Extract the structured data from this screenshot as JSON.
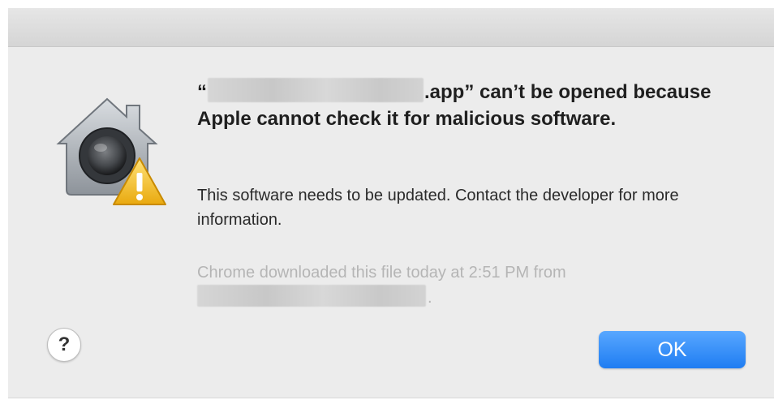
{
  "dialog": {
    "title_line": {
      "open_quote": "“",
      "suffix": ".app” can’t be opened because Apple cannot check it for malicious software."
    },
    "message": "This software needs to be updated. Contact the developer for more information.",
    "source": {
      "prefix": "Chrome downloaded this file today at 2:51 PM from",
      "suffix": "."
    },
    "help_label": "?",
    "ok_label": "OK",
    "icon": "gatekeeper-lock-warning-icon",
    "colors": {
      "ok_button": "#1f7df2",
      "warning": "#f4c430"
    }
  }
}
